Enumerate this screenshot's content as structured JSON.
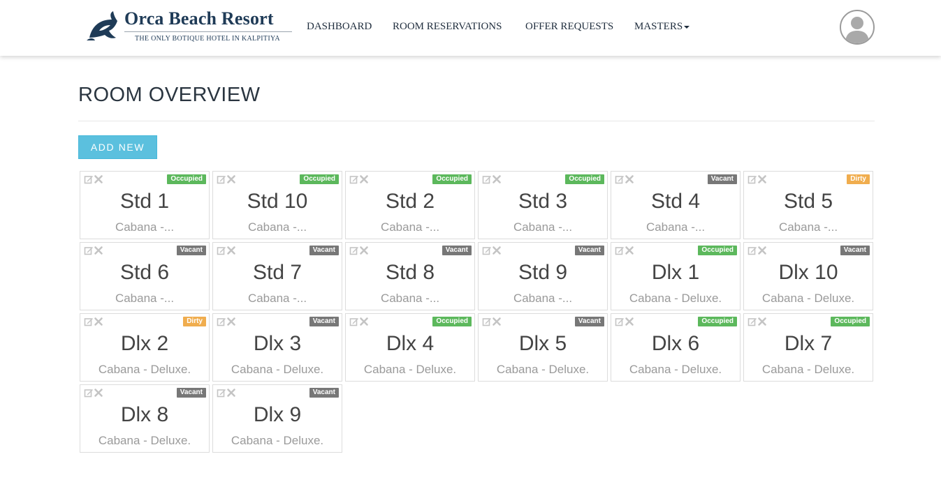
{
  "brand": {
    "name": "Orca Beach Resort",
    "tagline": "THE ONLY BOTIQUE HOTEL IN KALPITIYA",
    "color": "#1f3b57"
  },
  "nav": {
    "items": [
      {
        "label": "DASHBOARD"
      },
      {
        "label": "ROOM RESERVATIONS"
      },
      {
        "label": "OFFER REQUESTS"
      },
      {
        "label": "MASTERS"
      }
    ]
  },
  "page": {
    "title": "ROOM OVERVIEW",
    "add_button_label": "ADD NEW"
  },
  "status_colors": {
    "Occupied": "#5cb85c",
    "Vacant": "#777777",
    "Dirty": "#f0ad4e"
  },
  "rooms": [
    {
      "name": "Std 1",
      "type": "Cabana -...",
      "status": "Occupied"
    },
    {
      "name": "Std 10",
      "type": "Cabana -...",
      "status": "Occupied"
    },
    {
      "name": "Std 2",
      "type": "Cabana -...",
      "status": "Occupied"
    },
    {
      "name": "Std 3",
      "type": "Cabana -...",
      "status": "Occupied"
    },
    {
      "name": "Std 4",
      "type": "Cabana -...",
      "status": "Vacant"
    },
    {
      "name": "Std 5",
      "type": "Cabana -...",
      "status": "Dirty"
    },
    {
      "name": "Std 6",
      "type": "Cabana -...",
      "status": "Vacant"
    },
    {
      "name": "Std 7",
      "type": "Cabana -...",
      "status": "Vacant"
    },
    {
      "name": "Std 8",
      "type": "Cabana -...",
      "status": "Vacant"
    },
    {
      "name": "Std 9",
      "type": "Cabana -...",
      "status": "Vacant"
    },
    {
      "name": "Dlx 1",
      "type": "Cabana - Deluxe.",
      "status": "Occupied"
    },
    {
      "name": "Dlx 10",
      "type": "Cabana - Deluxe.",
      "status": "Vacant"
    },
    {
      "name": "Dlx 2",
      "type": "Cabana - Deluxe.",
      "status": "Dirty"
    },
    {
      "name": "Dlx 3",
      "type": "Cabana - Deluxe.",
      "status": "Vacant"
    },
    {
      "name": "Dlx 4",
      "type": "Cabana - Deluxe.",
      "status": "Occupied"
    },
    {
      "name": "Dlx 5",
      "type": "Cabana - Deluxe.",
      "status": "Vacant"
    },
    {
      "name": "Dlx 6",
      "type": "Cabana - Deluxe.",
      "status": "Occupied"
    },
    {
      "name": "Dlx 7",
      "type": "Cabana - Deluxe.",
      "status": "Occupied"
    },
    {
      "name": "Dlx 8",
      "type": "Cabana - Deluxe.",
      "status": "Vacant"
    },
    {
      "name": "Dlx 9",
      "type": "Cabana - Deluxe.",
      "status": "Vacant"
    }
  ]
}
